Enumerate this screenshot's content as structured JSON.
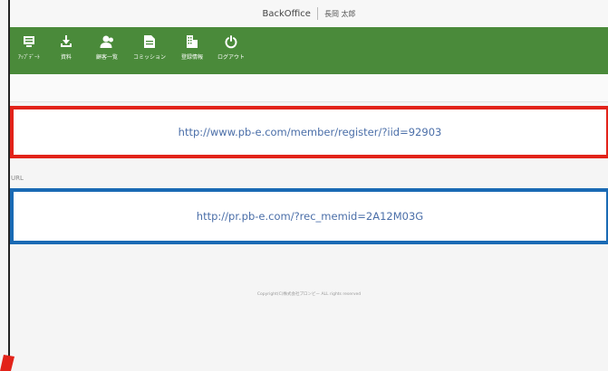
{
  "header": {
    "app_name": "BackOffice",
    "user_name": "長岡 太郎"
  },
  "nav": [
    {
      "label": "ｱｯﾌﾟﾃﾞｰﾄ",
      "icon": "monitor-icon"
    },
    {
      "label": "資料",
      "icon": "download-icon"
    },
    {
      "label": "顧客一覧",
      "icon": "users-icon"
    },
    {
      "label": "コミッション",
      "icon": "document-icon"
    },
    {
      "label": "登録情報",
      "icon": "building-icon"
    },
    {
      "label": "ログアウト",
      "icon": "power-icon"
    }
  ],
  "links": {
    "register_url": "http://www.pb-e.com/member/register/?iid=92903",
    "url_label": "URL",
    "rec_url": "http://pr.pb-e.com/?rec_memid=2A12M03G"
  },
  "footer": {
    "copyright": "Copyright(C)株式会社プロンビー ALL rights reserved"
  },
  "colors": {
    "nav_bg": "#4a8a3a",
    "red_border": "#e2231a",
    "blue_border": "#1a6ab4",
    "link": "#4a6ea8"
  }
}
